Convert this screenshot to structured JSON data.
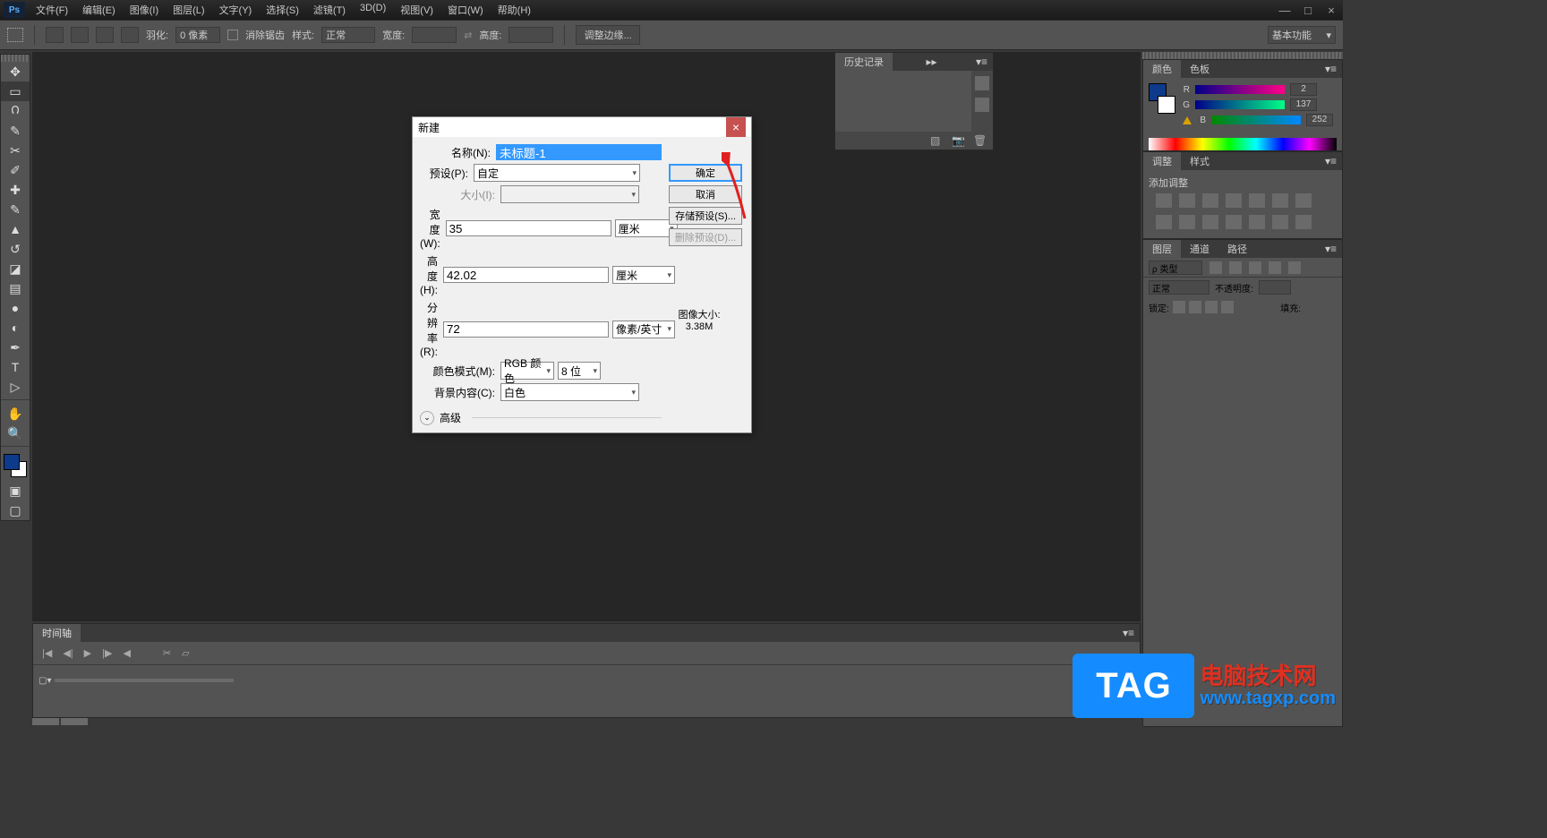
{
  "app": {
    "logo": "Ps"
  },
  "menu": [
    "文件(F)",
    "编辑(E)",
    "图像(I)",
    "图层(L)",
    "文字(Y)",
    "选择(S)",
    "滤镜(T)",
    "3D(D)",
    "视图(V)",
    "窗口(W)",
    "帮助(H)"
  ],
  "winControls": {
    "min": "—",
    "max": "□",
    "close": "×"
  },
  "optionbar": {
    "feather_label": "羽化:",
    "feather_value": "0 像素",
    "antialias": "消除锯齿",
    "style_label": "样式:",
    "style_value": "正常",
    "width_label": "宽度:",
    "height_label": "高度:",
    "refine": "调整边缘...",
    "workspace": "基本功能"
  },
  "timeline": {
    "tab": "时间轴"
  },
  "history": {
    "title": "历史记录"
  },
  "panels": {
    "color": {
      "tab1": "颜色",
      "tab2": "色板",
      "r": {
        "label": "R",
        "val": "2"
      },
      "g": {
        "label": "G",
        "val": "137"
      },
      "b": {
        "label": "B",
        "val": "252"
      }
    },
    "adjust": {
      "tab1": "调整",
      "tab2": "样式",
      "add": "添加调整"
    },
    "layers": {
      "tab1": "图层",
      "tab2": "通道",
      "tab3": "路径",
      "kind": "ρ 类型",
      "mode": "正常",
      "opacity_label": "不透明度:",
      "lock_label": "锁定:",
      "fill_label": "填充:"
    }
  },
  "dialog": {
    "title": "新建",
    "name_label": "名称(N):",
    "name_value": "未标题-1",
    "preset_label": "预设(P):",
    "preset_value": "自定",
    "size_label": "大小(I):",
    "width_label": "宽度(W):",
    "width_value": "35",
    "width_unit": "厘米",
    "height_label": "高度(H):",
    "height_value": "42.02",
    "height_unit": "厘米",
    "res_label": "分辨率(R):",
    "res_value": "72",
    "res_unit": "像素/英寸",
    "color_label": "颜色模式(M):",
    "color_value": "RGB 颜色",
    "bits": "8 位",
    "bg_label": "背景内容(C):",
    "bg_value": "白色",
    "advanced": "高级",
    "imgsize_label": "图像大小:",
    "imgsize_value": "3.38M",
    "ok": "确定",
    "cancel": "取消",
    "save_preset": "存储预设(S)...",
    "del_preset": "删除预设(D)..."
  },
  "watermark": {
    "tag": "TAG",
    "line1": "电脑技术网",
    "line2": "www.tagxp.com"
  }
}
